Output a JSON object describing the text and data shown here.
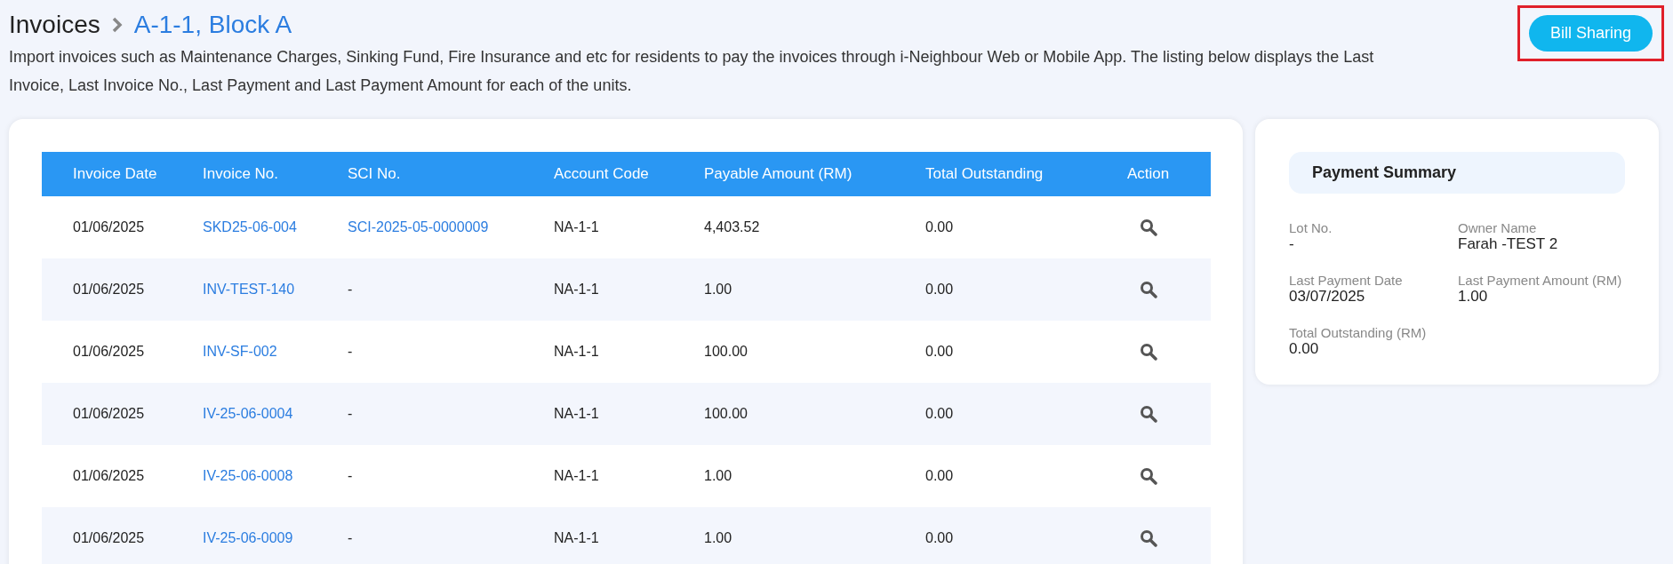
{
  "header": {
    "title": "Invoices",
    "breadcrumb": "A-1-1, Block A",
    "description": "Import invoices such as Maintenance Charges, Sinking Fund, Fire Insurance and etc for residents to pay the invoices through i-Neighbour Web or Mobile App. The listing below displays the Last Invoice, Last Invoice No., Last Payment and Last Payment Amount for each of the units.",
    "button": {
      "label": "Bill Sharing",
      "highlighted": true
    }
  },
  "table": {
    "columns": [
      "Invoice Date",
      "Invoice No.",
      "SCI No.",
      "Account Code",
      "Payable Amount (RM)",
      "Total Outstanding",
      "Action"
    ],
    "rows": [
      {
        "cells": [
          {
            "text": "01/06/2025",
            "kind": "text"
          },
          {
            "text": "SKD25-06-004",
            "kind": "link"
          },
          {
            "text": "SCI-2025-05-0000009",
            "kind": "link"
          },
          {
            "text": "NA-1-1",
            "kind": "text"
          },
          {
            "text": "4,403.52",
            "kind": "text"
          },
          {
            "text": "0.00",
            "kind": "text"
          }
        ]
      },
      {
        "cells": [
          {
            "text": "01/06/2025",
            "kind": "text"
          },
          {
            "text": "INV-TEST-140",
            "kind": "link"
          },
          {
            "text": "-",
            "kind": "text"
          },
          {
            "text": "NA-1-1",
            "kind": "text"
          },
          {
            "text": "1.00",
            "kind": "text"
          },
          {
            "text": "0.00",
            "kind": "text"
          }
        ]
      },
      {
        "cells": [
          {
            "text": "01/06/2025",
            "kind": "text"
          },
          {
            "text": "INV-SF-002",
            "kind": "link"
          },
          {
            "text": "-",
            "kind": "text"
          },
          {
            "text": "NA-1-1",
            "kind": "text"
          },
          {
            "text": "100.00",
            "kind": "text"
          },
          {
            "text": "0.00",
            "kind": "text"
          }
        ]
      },
      {
        "cells": [
          {
            "text": "01/06/2025",
            "kind": "text"
          },
          {
            "text": "IV-25-06-0004",
            "kind": "link"
          },
          {
            "text": "-",
            "kind": "text"
          },
          {
            "text": "NA-1-1",
            "kind": "text"
          },
          {
            "text": "100.00",
            "kind": "text"
          },
          {
            "text": "0.00",
            "kind": "text"
          }
        ]
      },
      {
        "cells": [
          {
            "text": "01/06/2025",
            "kind": "text"
          },
          {
            "text": "IV-25-06-0008",
            "kind": "link"
          },
          {
            "text": "-",
            "kind": "text"
          },
          {
            "text": "NA-1-1",
            "kind": "text"
          },
          {
            "text": "1.00",
            "kind": "text"
          },
          {
            "text": "0.00",
            "kind": "text"
          }
        ]
      },
      {
        "cells": [
          {
            "text": "01/06/2025",
            "kind": "text"
          },
          {
            "text": "IV-25-06-0009",
            "kind": "link"
          },
          {
            "text": "-",
            "kind": "text"
          },
          {
            "text": "NA-1-1",
            "kind": "text"
          },
          {
            "text": "1.00",
            "kind": "text"
          },
          {
            "text": "0.00",
            "kind": "text"
          }
        ]
      }
    ]
  },
  "summary": {
    "title": "Payment Summary",
    "fields": [
      {
        "label": "Lot No.",
        "value": "-"
      },
      {
        "label": "Owner Name",
        "value": "Farah -TEST 2"
      },
      {
        "label": "Last Payment Date",
        "value": "03/07/2025"
      },
      {
        "label": "Last Payment Amount (RM)",
        "value": "1.00"
      },
      {
        "label": "Total Outstanding (RM)",
        "value": "0.00"
      }
    ]
  }
}
